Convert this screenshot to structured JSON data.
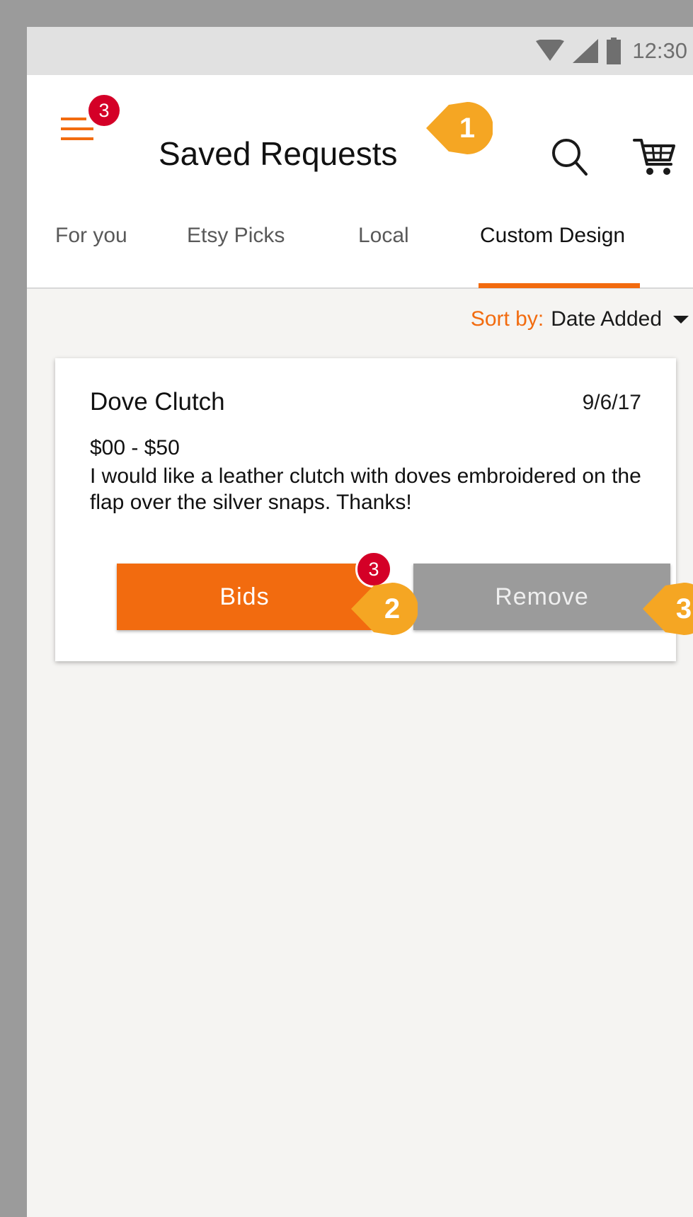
{
  "status_bar": {
    "time": "12:30",
    "icons": [
      "wifi-icon",
      "signal-icon",
      "battery-icon"
    ]
  },
  "header": {
    "title": "Saved Requests",
    "menu_badge": "3",
    "icons": [
      "menu-icon",
      "search-icon",
      "cart-icon"
    ]
  },
  "tabs": [
    {
      "label": "For you",
      "active": false
    },
    {
      "label": "Etsy Picks",
      "active": false
    },
    {
      "label": "Local",
      "active": false
    },
    {
      "label": "Custom Design",
      "active": true
    }
  ],
  "sort": {
    "label": "Sort by:",
    "value": "Date Added"
  },
  "request": {
    "title": "Dove Clutch",
    "date": "9/6/17",
    "price": "$00 - $50",
    "description": "I would like a leather clutch with doves embroidered on the flap over the silver snaps. Thanks!",
    "bids_label": "Bids",
    "bids_badge": "3",
    "remove_label": "Remove"
  },
  "callouts": [
    "1",
    "2",
    "3"
  ],
  "colors": {
    "accent": "#f26b0f",
    "badge": "#d40027",
    "callout": "#f5a623",
    "remove_button": "#9b9b9b"
  }
}
